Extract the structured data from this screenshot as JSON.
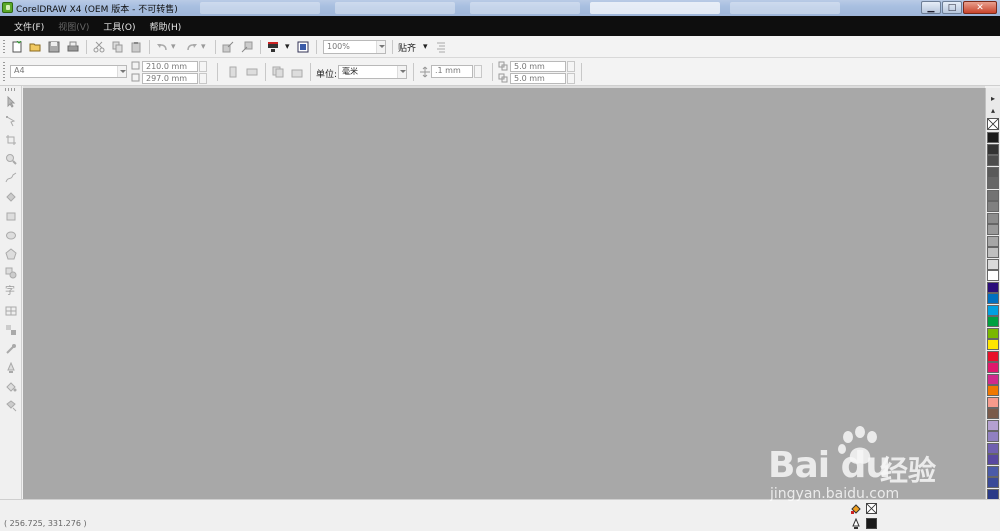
{
  "window": {
    "title": "CorelDRAW X4 (OEM 版本 - 不可转售)",
    "buttons": {
      "minimize": "▁",
      "maximize": "□",
      "close": "✕"
    }
  },
  "menu": {
    "items": [
      {
        "label": "文件(F)",
        "enabled": true
      },
      {
        "label": "视图(V)",
        "enabled": false
      },
      {
        "label": "工具(O)",
        "enabled": true
      },
      {
        "label": "帮助(H)",
        "enabled": true
      }
    ]
  },
  "standard_toolbar": {
    "zoom": "100%",
    "snap_label": "贴齐",
    "icons": [
      "new-document-icon",
      "open-icon",
      "save-icon",
      "print-icon",
      "cut-icon",
      "copy-icon",
      "paste-icon",
      "undo-icon",
      "redo-icon",
      "import-icon",
      "export-icon",
      "application-launcher-icon",
      "welcome-screen-icon"
    ]
  },
  "property_bar": {
    "paper_size": "A4",
    "width": "210.0 mm",
    "height": "297.0 mm",
    "units_label": "单位:",
    "units_value": "毫米",
    "nudge": ".1 mm",
    "duplicate_x": "5.0 mm",
    "duplicate_y": "5.0 mm"
  },
  "toolbox": {
    "tools": [
      "pick-tool-icon",
      "shape-tool-icon",
      "crop-tool-icon",
      "zoom-tool-icon",
      "freehand-tool-icon",
      "smart-fill-tool-icon",
      "rectangle-tool-icon",
      "ellipse-tool-icon",
      "polygon-tool-icon",
      "basic-shapes-tool-icon",
      "text-tool-icon",
      "table-tool-icon",
      "interactive-blend-tool-icon",
      "eyedropper-tool-icon",
      "outline-tool-icon",
      "fill-tool-icon",
      "interactive-fill-tool-icon"
    ],
    "text_tool_label": "字"
  },
  "palette": {
    "colors": [
      "#1a1a1a",
      "#333333",
      "#4d4d4d",
      "#595959",
      "#666666",
      "#737373",
      "#808080",
      "#8c8c8c",
      "#999999",
      "#a6a6a6",
      "#bfbfbf",
      "#d9d9d9",
      "#ffffff",
      "#2b0e7a",
      "#0070c0",
      "#00a0e0",
      "#00a040",
      "#7ab800",
      "#ffe600",
      "#e8102a",
      "#e0186c",
      "#d02a8c",
      "#f07800",
      "#f59a8c",
      "#7a5a4a",
      "#b4a0d0",
      "#9080c0",
      "#7060b0",
      "#5848a0",
      "#4a5aa8",
      "#3a4a98",
      "#2a3a88"
    ]
  },
  "status": {
    "coordinates": "( 256.725, 331.276 )"
  },
  "watermark": {
    "brand": "Bai  du",
    "cn": "经验",
    "url": "jingyan.baidu.com"
  }
}
